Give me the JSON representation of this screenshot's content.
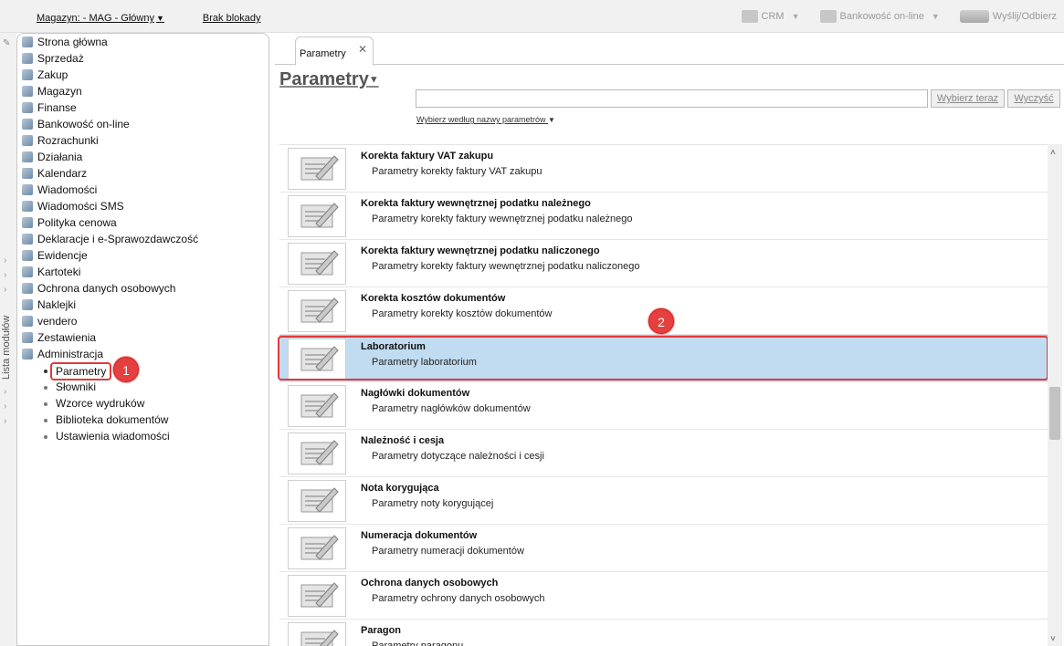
{
  "topbar": {
    "magazyn_label": "Magazyn: - MAG - Główny",
    "brak_blokady": "Brak blokady",
    "crm": "CRM",
    "bankowosc": "Bankowość on-line",
    "wyslij": "Wyślij/Odbierz"
  },
  "rail": {
    "label": "Lista modułów"
  },
  "sidebar": {
    "modules": [
      "Strona główna",
      "Sprzedaż",
      "Zakup",
      "Magazyn",
      "Finanse",
      "Bankowość on-line",
      "Rozrachunki",
      "Działania",
      "Kalendarz",
      "Wiadomości",
      "Wiadomości SMS",
      "Polityka cenowa",
      "Deklaracje i e-Sprawozdawczość",
      "Ewidencje",
      "Kartoteki",
      "Ochrona danych osobowych",
      "Naklejki",
      "vendero",
      "Zestawienia",
      "Administracja"
    ],
    "submodules": [
      "Parametry",
      "Słowniki",
      "Wzorce wydruków",
      "Biblioteka dokumentów",
      "Ustawienia wiadomości"
    ],
    "active_submodule": "Parametry"
  },
  "callouts": {
    "one": "1",
    "two": "2"
  },
  "tab": {
    "label": "Parametry",
    "close": "✕"
  },
  "page": {
    "title": "Parametry"
  },
  "search": {
    "value": "",
    "choose_button": "Wybierz teraz",
    "clear_button": "Wyczyść",
    "filter_link": "Wybierz według nazwy parametrów"
  },
  "items": [
    {
      "title": "Korekta faktury VAT zakupu",
      "desc": "Parametry korekty faktury VAT zakupu"
    },
    {
      "title": "Korekta faktury wewnętrznej podatku należnego",
      "desc": "Parametry korekty faktury wewnętrznej podatku należnego"
    },
    {
      "title": "Korekta faktury wewnętrznej podatku naliczonego",
      "desc": "Parametry korekty faktury wewnętrznej podatku naliczonego"
    },
    {
      "title": "Korekta kosztów dokumentów",
      "desc": "Parametry korekty kosztów dokumentów"
    },
    {
      "title": "Laboratorium",
      "desc": "Parametry laboratorium"
    },
    {
      "title": "Nagłówki dokumentów",
      "desc": "Parametry nagłówków dokumentów"
    },
    {
      "title": "Należność i cesja",
      "desc": "Parametry dotyczące należności i cesji"
    },
    {
      "title": "Nota korygująca",
      "desc": "Parametry noty korygującej"
    },
    {
      "title": "Numeracja dokumentów",
      "desc": "Parametry numeracji dokumentów"
    },
    {
      "title": "Ochrona danych osobowych",
      "desc": "Parametry ochrony danych osobowych"
    },
    {
      "title": "Paragon",
      "desc": "Parametry paragonu"
    }
  ],
  "selected_index": 4,
  "colors": {
    "selection": "#c1dcf1",
    "callout": "#e54040"
  }
}
